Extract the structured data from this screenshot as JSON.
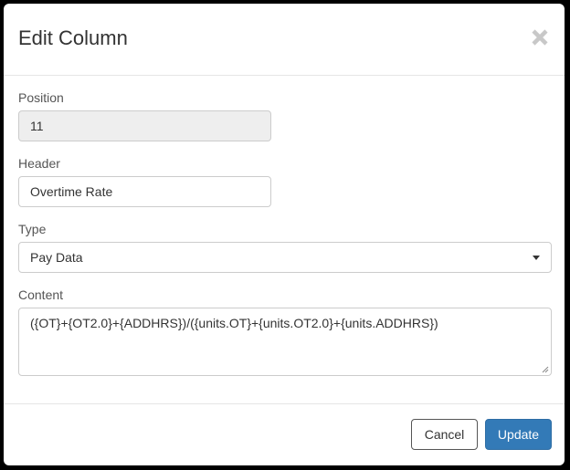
{
  "dialog": {
    "title": "Edit Column"
  },
  "fields": {
    "position": {
      "label": "Position",
      "value": "11"
    },
    "header": {
      "label": "Header",
      "value": "Overtime Rate"
    },
    "type": {
      "label": "Type",
      "selected": "Pay Data"
    },
    "content": {
      "label": "Content",
      "value": "({OT}+{OT2.0}+{ADDHRS})/({units.OT}+{units.OT2.0}+{units.ADDHRS})"
    }
  },
  "footer": {
    "cancel_label": "Cancel",
    "update_label": "Update"
  },
  "colors": {
    "primary": "#337ab7",
    "readonly_bg": "#eeeeee",
    "close_icon": "#c8c8c8"
  }
}
